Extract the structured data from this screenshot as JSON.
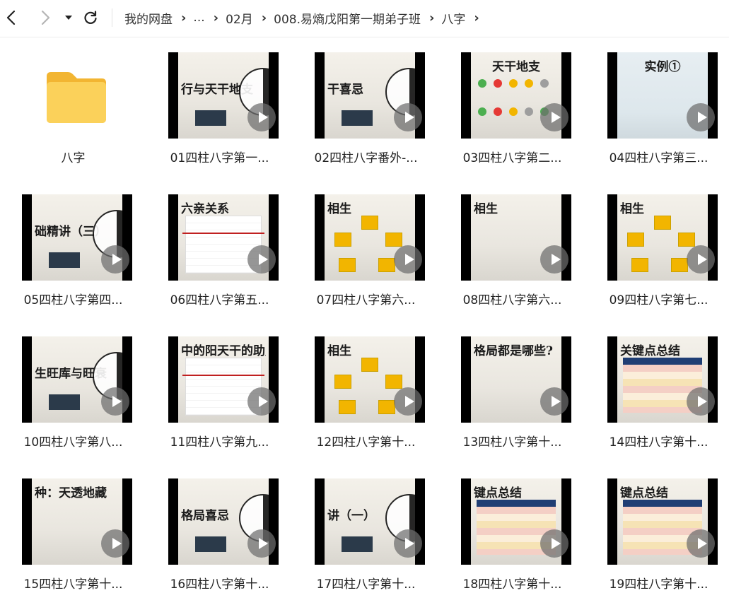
{
  "toolbar": {
    "breadcrumb": [
      {
        "label": "我的网盘"
      },
      {
        "label": "..."
      },
      {
        "label": "02月"
      },
      {
        "label": "008.易熵戊阳第一期弟子班"
      },
      {
        "label": "八字"
      }
    ]
  },
  "items": [
    {
      "type": "folder",
      "label": "八字",
      "icon": "folder-icon"
    },
    {
      "type": "video",
      "label": "01四柱八字第一...",
      "thumb_text": "行与天干地支",
      "style": "taiji"
    },
    {
      "type": "video",
      "label": "02四柱八字番外-...",
      "thumb_text": "干喜忌",
      "style": "taiji"
    },
    {
      "type": "video",
      "label": "03四柱八字第二...",
      "thumb_text": "天干地支",
      "style": "circles"
    },
    {
      "type": "video",
      "label": "04四柱八字第三...",
      "thumb_text": "实例①",
      "style": "sky"
    },
    {
      "type": "video",
      "label": "05四柱八字第四...",
      "thumb_text": "础精讲（三）",
      "style": "taiji"
    },
    {
      "type": "video",
      "label": "06四柱八字第五...",
      "thumb_text": "六亲关系",
      "style": "table"
    },
    {
      "type": "video",
      "label": "07四柱八字第六...",
      "thumb_text": "相生",
      "style": "wheel"
    },
    {
      "type": "video",
      "label": "08四柱八字第六...",
      "thumb_text": "相生",
      "style": "plain"
    },
    {
      "type": "video",
      "label": "09四柱八字第七...",
      "thumb_text": "相生",
      "style": "wheel"
    },
    {
      "type": "video",
      "label": "10四柱八字第八...",
      "thumb_text": "生旺库与旺衰",
      "style": "taiji"
    },
    {
      "type": "video",
      "label": "11四柱八字第九...",
      "thumb_text": "中的阳天干的助财",
      "style": "table"
    },
    {
      "type": "video",
      "label": "12四柱八字第十...",
      "thumb_text": "相生",
      "style": "wheel"
    },
    {
      "type": "video",
      "label": "13四柱八字第十...",
      "thumb_text": "格局都是哪些?",
      "style": "plain"
    },
    {
      "type": "video",
      "label": "14四柱八字第十...",
      "thumb_text": "关键点总结",
      "style": "bars"
    },
    {
      "type": "video",
      "label": "15四柱八字第十...",
      "thumb_text": "种：天透地藏",
      "style": "plain"
    },
    {
      "type": "video",
      "label": "16四柱八字第十...",
      "thumb_text": "格局喜忌",
      "style": "taiji"
    },
    {
      "type": "video",
      "label": "17四柱八字第十...",
      "thumb_text": "讲（一）",
      "style": "taiji"
    },
    {
      "type": "video",
      "label": "18四柱八字第十...",
      "thumb_text": "键点总结",
      "style": "bars"
    },
    {
      "type": "video",
      "label": "19四柱八字第十...",
      "thumb_text": "键点总结",
      "style": "bars"
    }
  ],
  "icons": {
    "back": "chevron-left-icon",
    "forward": "chevron-right-icon",
    "history": "caret-down-icon",
    "refresh": "refresh-icon",
    "play": "play-icon"
  },
  "colors": {
    "folder": "#f7c948",
    "play_overlay": "#6e6e6e"
  }
}
